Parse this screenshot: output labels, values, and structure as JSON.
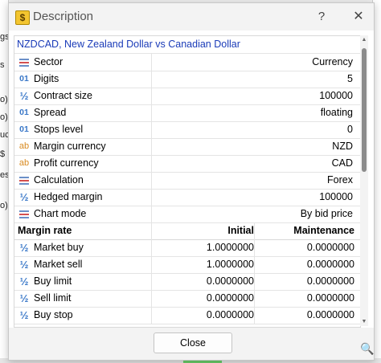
{
  "window": {
    "title": "Description",
    "help_label": "?",
    "close_label": "✕"
  },
  "symbol": {
    "heading": "NZDCAD, New Zealand Dollar vs Canadian Dollar"
  },
  "properties": [
    {
      "icon": "list-icon",
      "label": "Sector",
      "value": "Currency"
    },
    {
      "icon": "digits-icon",
      "label": "Digits",
      "value": "5"
    },
    {
      "icon": "fraction-icon",
      "label": "Contract size",
      "value": "100000"
    },
    {
      "icon": "digits-icon",
      "label": "Spread",
      "value": "floating"
    },
    {
      "icon": "digits-icon",
      "label": "Stops level",
      "value": "0"
    },
    {
      "icon": "text-icon",
      "label": "Margin currency",
      "value": "NZD"
    },
    {
      "icon": "text-icon",
      "label": "Profit currency",
      "value": "CAD"
    },
    {
      "icon": "list-icon",
      "label": "Calculation",
      "value": "Forex"
    },
    {
      "icon": "fraction-icon",
      "label": "Hedged margin",
      "value": "100000"
    },
    {
      "icon": "list-icon",
      "label": "Chart mode",
      "value": "By bid price"
    }
  ],
  "margin_table": {
    "headers": {
      "rate": "Margin rate",
      "initial": "Initial",
      "maintenance": "Maintenance"
    },
    "rows": [
      {
        "label": "Market buy",
        "initial": "1.0000000",
        "maintenance": "0.0000000"
      },
      {
        "label": "Market sell",
        "initial": "1.0000000",
        "maintenance": "0.0000000"
      },
      {
        "label": "Buy limit",
        "initial": "0.0000000",
        "maintenance": "0.0000000"
      },
      {
        "label": "Sell limit",
        "initial": "0.0000000",
        "maintenance": "0.0000000"
      },
      {
        "label": "Buy stop",
        "initial": "0.0000000",
        "maintenance": "0.0000000"
      }
    ]
  },
  "icons": {
    "digits": "01",
    "fraction": "½",
    "text": "ab",
    "app": "$",
    "zoom": "🔍"
  },
  "footer": {
    "close_label": "Close"
  },
  "background_fragments": [
    "gs",
    "s",
    "o)",
    "o)",
    "uc",
    "$",
    "es",
    "o)"
  ],
  "colors": {
    "link": "#1a3bb8",
    "icon_blue": "#3a78c8",
    "icon_orange": "#d88a20"
  }
}
